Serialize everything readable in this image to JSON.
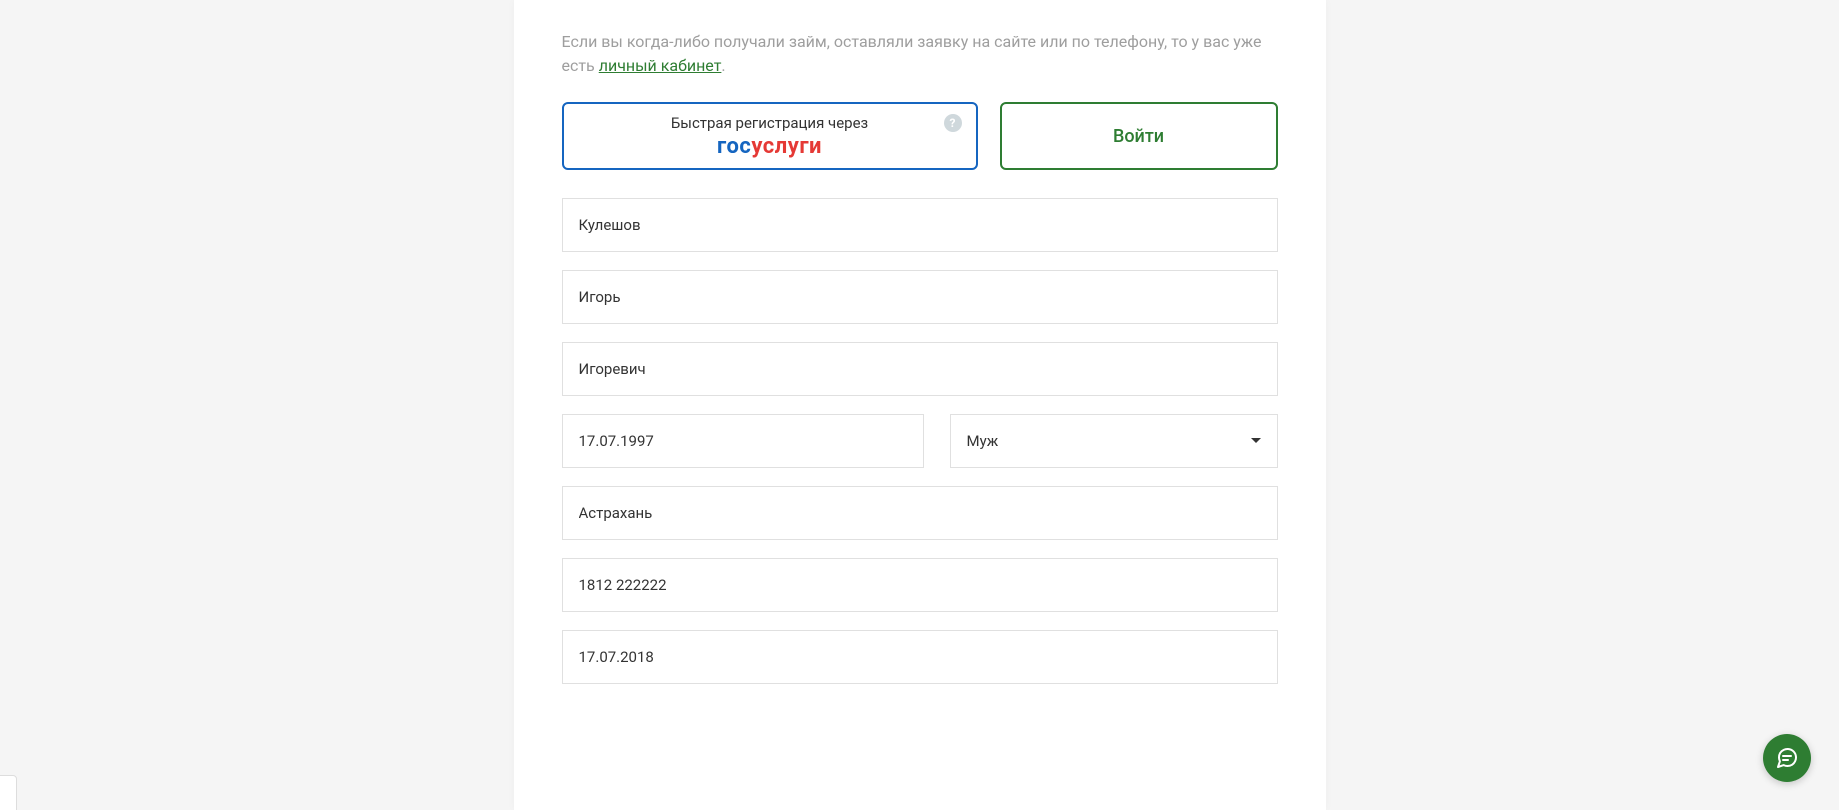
{
  "intro": {
    "text_before_link": "Если вы когда-либо получали займ, оставляли заявку на сайте или по телефону, то у вас уже есть ",
    "link_text": "личный кабинет",
    "text_after_link": "."
  },
  "buttons": {
    "gosuslugi_top": "Быстрая регистрация через",
    "gosuslugi_logo_part1": "гос",
    "gosuslugi_logo_part2": "услуги",
    "help_symbol": "?",
    "login": "Войти"
  },
  "form": {
    "last_name": "Кулешов",
    "first_name": "Игорь",
    "patronymic": "Игоревич",
    "birth_date": "17.07.1997",
    "gender": "Муж",
    "city": "Астрахань",
    "passport": "1812 222222",
    "issue_date": "17.07.2018"
  }
}
